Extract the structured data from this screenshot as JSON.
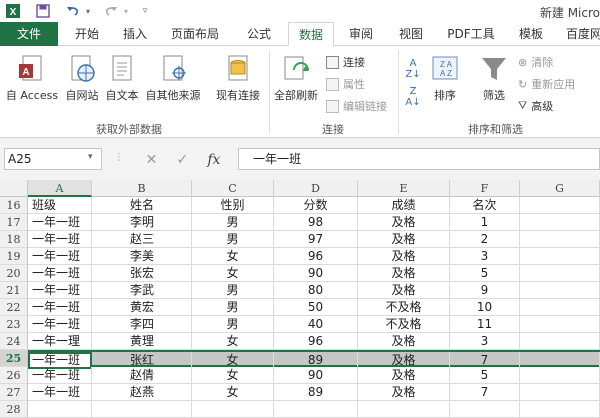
{
  "window_title": "新建 Micro",
  "quick_access": {
    "save_icon": "save-icon",
    "undo_icon": "undo-icon",
    "redo_icon": "redo-icon",
    "excel_icon": "excel-icon"
  },
  "tabs": [
    "文件",
    "开始",
    "插入",
    "页面布局",
    "公式",
    "数据",
    "审阅",
    "视图",
    "PDF工具",
    "模板",
    "百度网"
  ],
  "active_tab": "数据",
  "ribbon": {
    "external_group": {
      "label": "获取外部数据",
      "buttons": [
        "自 Access",
        "自网站",
        "自文本",
        "自其他来源",
        "现有连接"
      ]
    },
    "connections_group": {
      "label": "连接",
      "refresh_all": "全部刷新",
      "connections": "连接",
      "properties": "属性",
      "edit_links": "编辑链接"
    },
    "sort_filter_group": {
      "label": "排序和筛选",
      "sort": "排序",
      "filter": "筛选",
      "clear": "清除",
      "reapply": "重新应用",
      "advanced": "高级"
    }
  },
  "formula_bar": {
    "name_box": "A25",
    "cancel": "✕",
    "enter": "✓",
    "fx": "fx",
    "formula": "一年一班"
  },
  "columns": [
    "A",
    "B",
    "C",
    "D",
    "E",
    "F",
    "G"
  ],
  "selected_row": "25",
  "rows": [
    {
      "num": "16",
      "cells": [
        "班级",
        "姓名",
        "性别",
        "分数",
        "成绩",
        "名次",
        ""
      ]
    },
    {
      "num": "17",
      "cells": [
        "一年一班",
        "李明",
        "男",
        "98",
        "及格",
        "1",
        ""
      ]
    },
    {
      "num": "18",
      "cells": [
        "一年一班",
        "赵三",
        "男",
        "97",
        "及格",
        "2",
        ""
      ]
    },
    {
      "num": "19",
      "cells": [
        "一年一班",
        "李美",
        "女",
        "96",
        "及格",
        "3",
        ""
      ]
    },
    {
      "num": "20",
      "cells": [
        "一年一班",
        "张宏",
        "女",
        "90",
        "及格",
        "5",
        ""
      ]
    },
    {
      "num": "21",
      "cells": [
        "一年一班",
        "李武",
        "男",
        "80",
        "及格",
        "9",
        ""
      ]
    },
    {
      "num": "22",
      "cells": [
        "一年一班",
        "黄宏",
        "男",
        "50",
        "不及格",
        "10",
        ""
      ]
    },
    {
      "num": "23",
      "cells": [
        "一年一班",
        "李四",
        "男",
        "40",
        "不及格",
        "11",
        ""
      ]
    },
    {
      "num": "24",
      "cells": [
        "一年一理",
        "黄理",
        "女",
        "96",
        "及格",
        "3",
        ""
      ]
    },
    {
      "num": "25",
      "cells": [
        "一年一班",
        "张红",
        "女",
        "89",
        "及格",
        "7",
        ""
      ]
    },
    {
      "num": "26",
      "cells": [
        "一年一班",
        "赵倩",
        "女",
        "90",
        "及格",
        "5",
        ""
      ]
    },
    {
      "num": "27",
      "cells": [
        "一年一班",
        "赵燕",
        "女",
        "89",
        "及格",
        "7",
        ""
      ]
    },
    {
      "num": "28",
      "cells": [
        "",
        "",
        "",
        "",
        "",
        "",
        ""
      ]
    }
  ],
  "colors": {
    "accent": "#217346",
    "selection": "#c6c6c6"
  }
}
